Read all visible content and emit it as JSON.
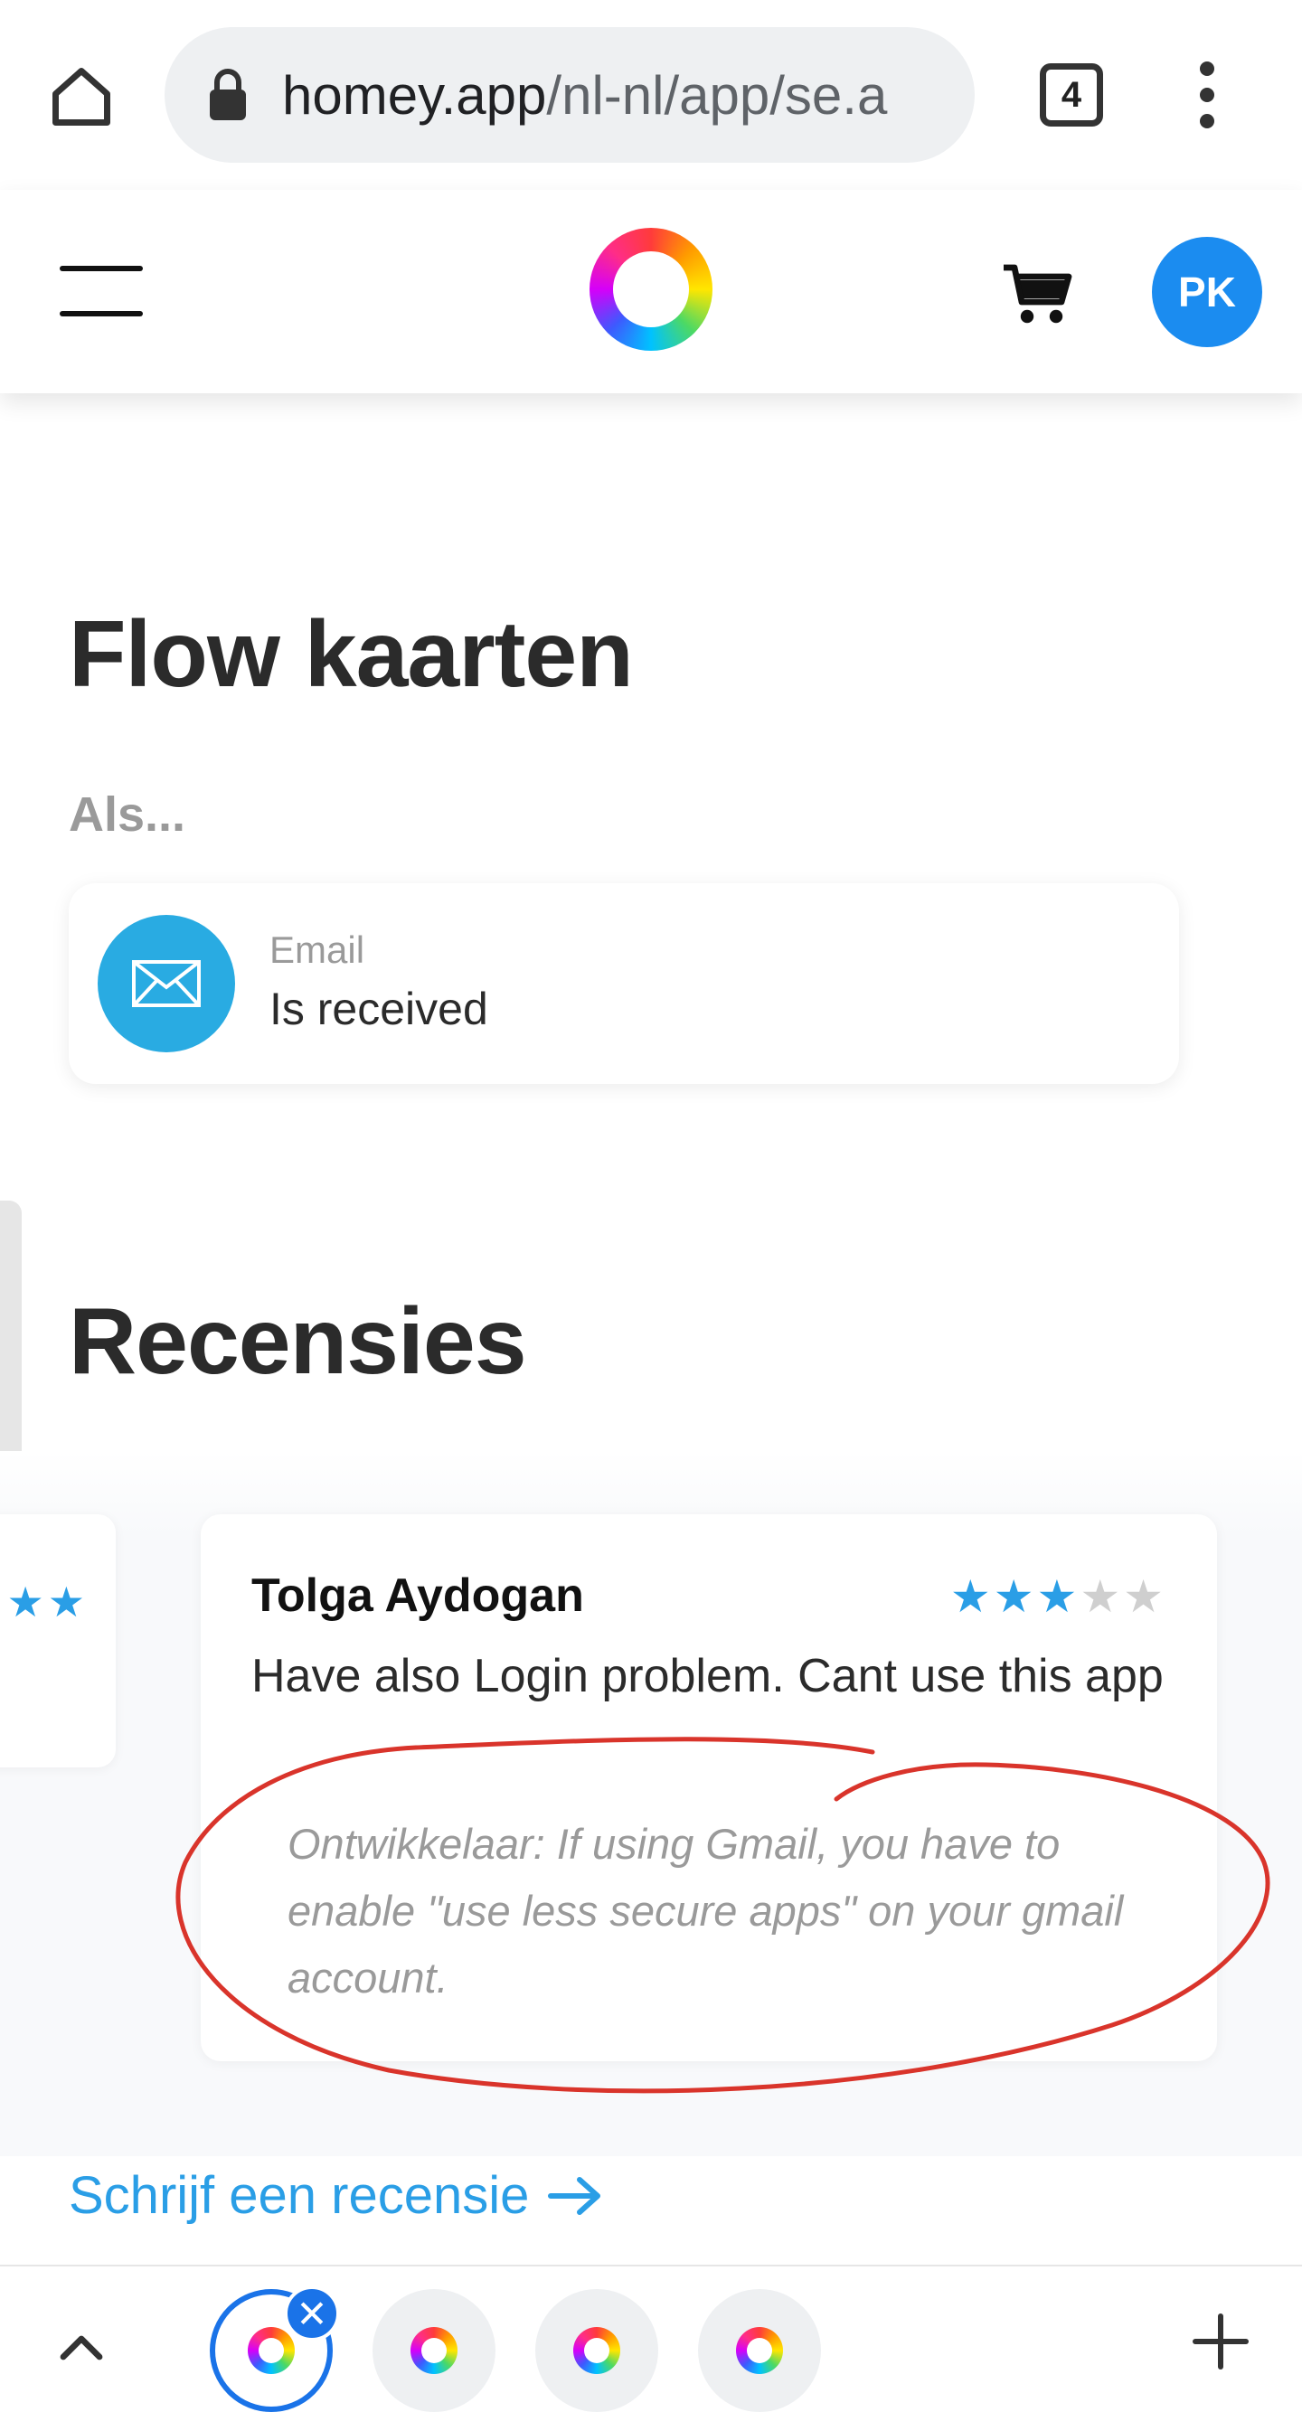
{
  "browser": {
    "url_host": "homey.app",
    "url_path": "/nl-nl/app/se.a",
    "tab_count": "4",
    "icons": [
      "home-icon",
      "lock-icon",
      "tabs-icon",
      "more-vert-icon"
    ]
  },
  "header": {
    "avatar_initials": "PK",
    "icons": [
      "hamburger-icon",
      "homey-logo",
      "cart-icon"
    ]
  },
  "flow": {
    "title": "Flow kaarten",
    "condition_label": "Als...",
    "card": {
      "category": "Email",
      "name": "Is received",
      "icon": "envelope-icon",
      "icon_color": "#29abe2"
    }
  },
  "reviews": {
    "title": "Recensies",
    "items": [
      {
        "author": "Tolga Aydogan",
        "rating": 3,
        "max_rating": 5,
        "body": "Have also Login problem. Cant use this app",
        "reply": "Ontwikkelaar: If using Gmail, you have to enable \"use less secure apps\" on your gmail account."
      }
    ],
    "write_link": "Schrijf een recensie",
    "star_color": "#2a9ee6"
  },
  "tab_strip": {
    "tabs": [
      "homey-tab-active",
      "homey-search-tab",
      "homey-tab",
      "homey-tab"
    ],
    "active_close": "✕",
    "accent": "#1a73e8"
  },
  "colors": {
    "annotation": "#d9342b",
    "link": "#2a9ee6",
    "avatar": "#1b8cf0"
  }
}
